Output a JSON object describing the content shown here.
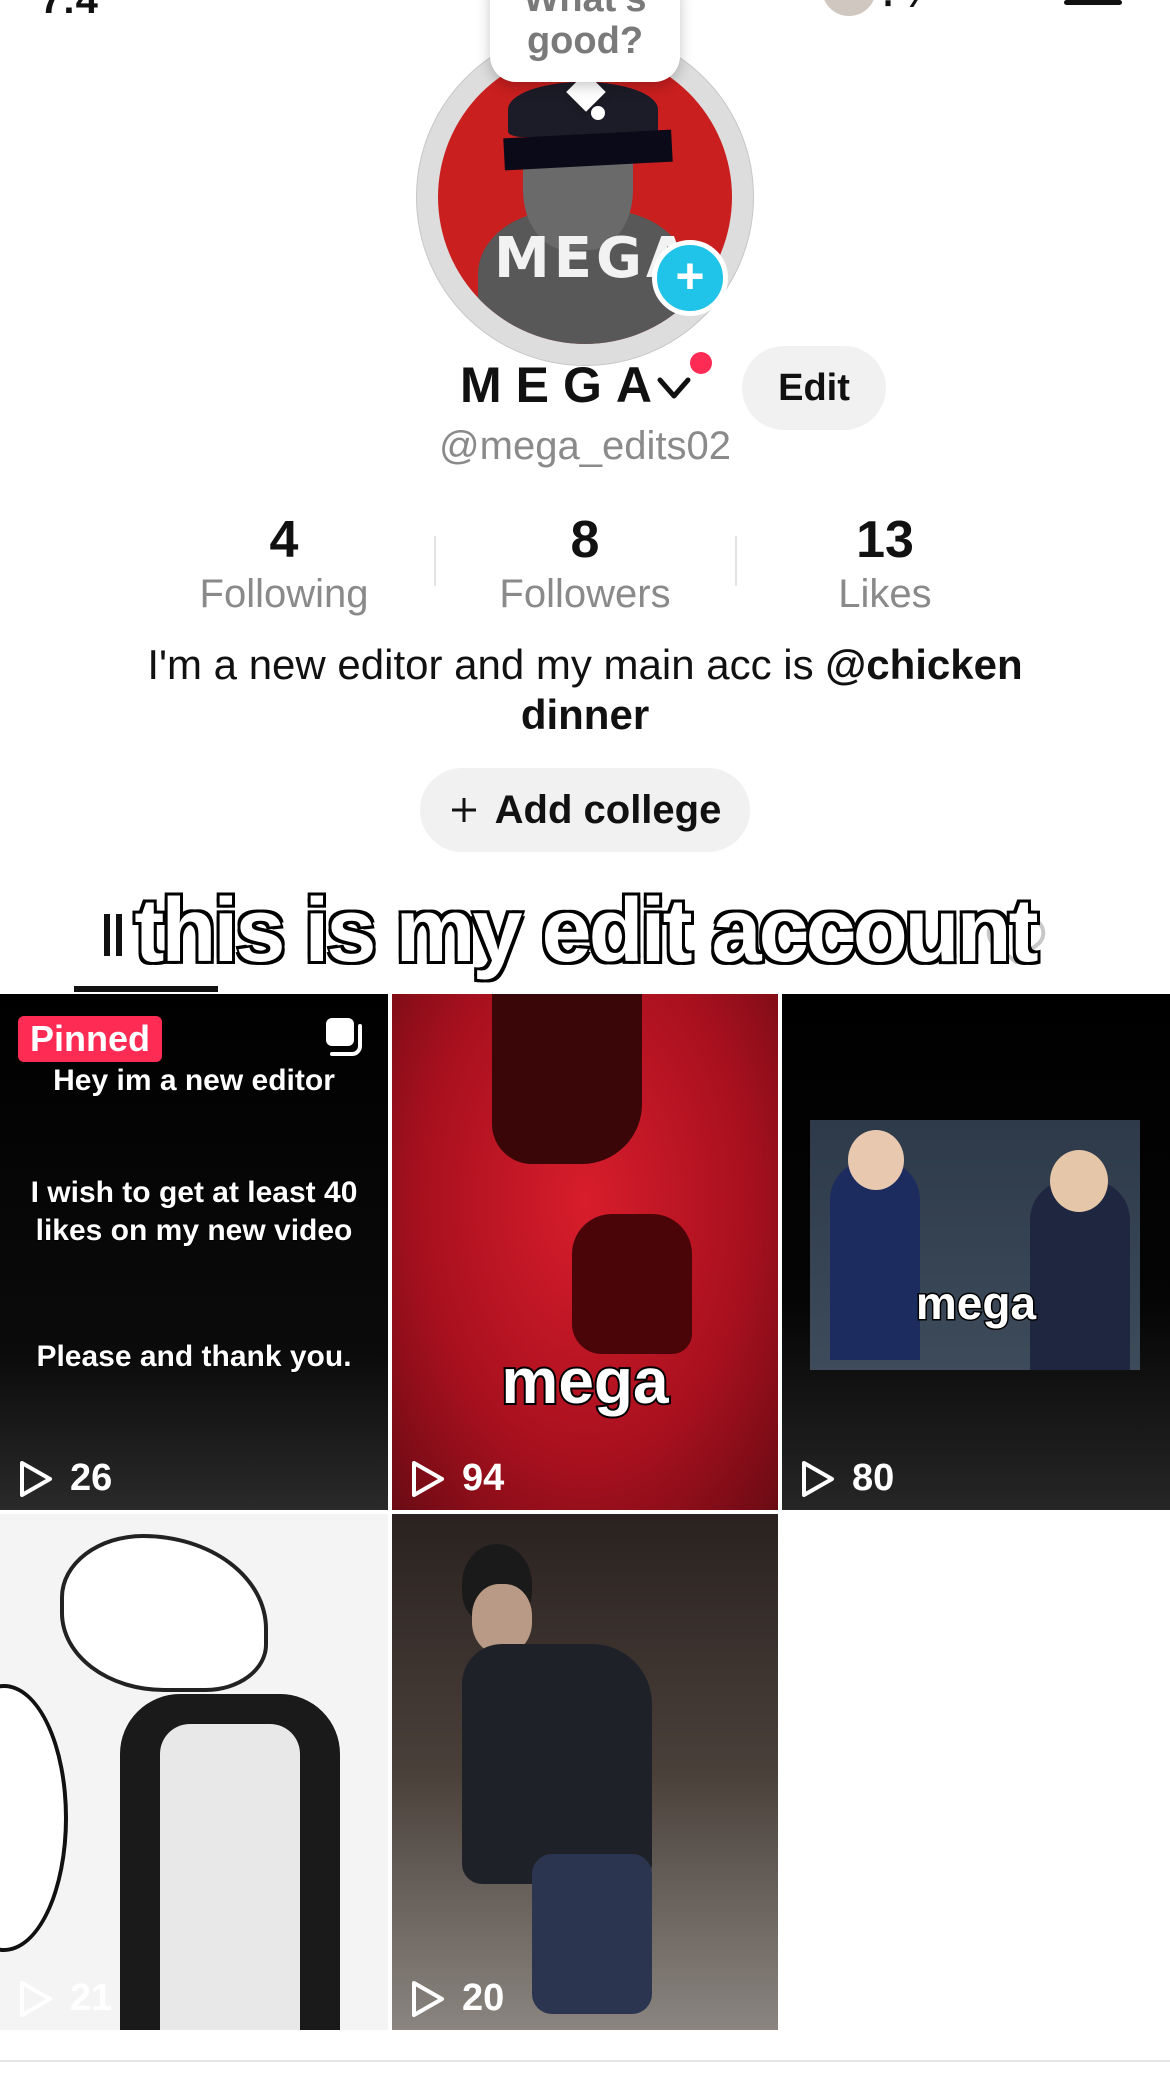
{
  "status_bar": {
    "time_fragment": "7:4",
    "right_glyphs": "⁝ ⁄"
  },
  "profile": {
    "bubble_text_1": "What's",
    "bubble_text_2": "good?",
    "avatar_text": "MEGA",
    "name": "MEGA",
    "edit_label": "Edit",
    "handle": "@mega_edits02",
    "bio_prefix": "I'm a new editor and my main acc is ",
    "bio_mention_1": "@chicken",
    "bio_mention_2": "dinner",
    "add_college_label": "Add college"
  },
  "stats": [
    {
      "value": "4",
      "label": "Following"
    },
    {
      "value": "8",
      "label": "Followers"
    },
    {
      "value": "13",
      "label": "Likes"
    }
  ],
  "overlay_caption": "this is my edit account",
  "grid": {
    "pinned_label": "Pinned",
    "tiles": [
      {
        "views": "26",
        "lines": [
          "Hey im a new editor",
          "I wish to get at least 40",
          "likes on my new video",
          "Please and thank you."
        ]
      },
      {
        "views": "94",
        "caption": "mega"
      },
      {
        "views": "80",
        "caption": "mega"
      },
      {
        "views": "21"
      },
      {
        "views": "20"
      }
    ]
  },
  "colors": {
    "accent_red": "#fe2c55",
    "plus_blue": "#20c4e8"
  }
}
